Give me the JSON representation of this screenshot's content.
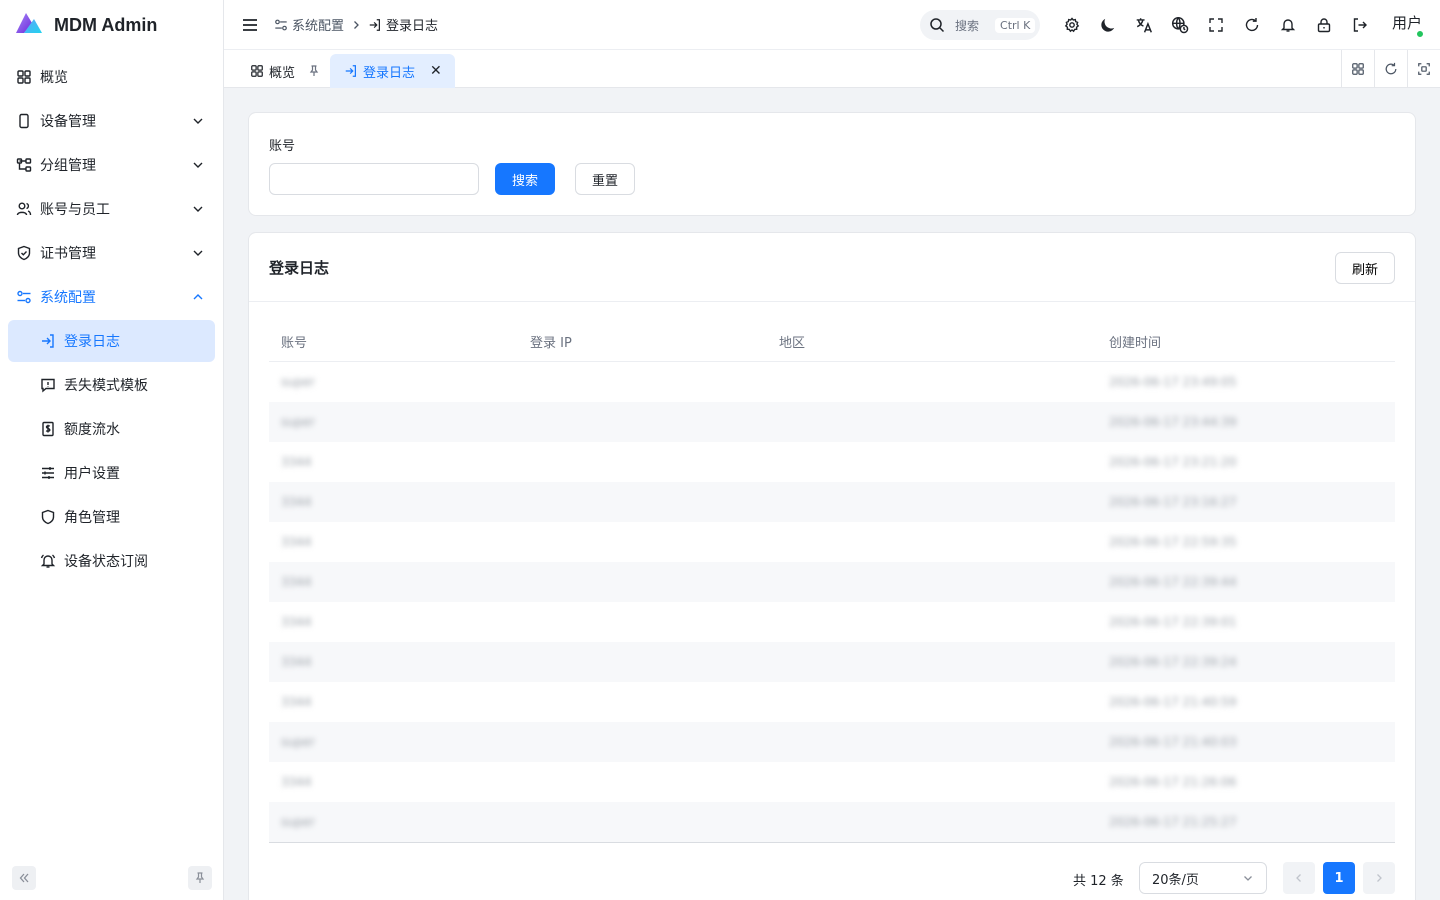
{
  "app": {
    "name": "MDM Admin"
  },
  "sidebar": {
    "items": [
      {
        "label": "概览",
        "icon": "dashboard-icon"
      },
      {
        "label": "设备管理",
        "icon": "phone-icon"
      },
      {
        "label": "分组管理",
        "icon": "tree-icon"
      },
      {
        "label": "账号与员工",
        "icon": "users-icon"
      },
      {
        "label": "证书管理",
        "icon": "shield-check-icon"
      },
      {
        "label": "系统配置",
        "icon": "settings-sliders-icon"
      }
    ],
    "sub_items": [
      {
        "label": "登录日志",
        "icon": "login-icon"
      },
      {
        "label": "丢失模式模板",
        "icon": "message-alert-icon"
      },
      {
        "label": "额度流水",
        "icon": "receipt-icon"
      },
      {
        "label": "用户设置",
        "icon": "sliders-icon"
      },
      {
        "label": "角色管理",
        "icon": "shield-icon"
      },
      {
        "label": "设备状态订阅",
        "icon": "bell-icon"
      }
    ]
  },
  "header": {
    "breadcrumb": [
      "系统配置",
      "登录日志"
    ],
    "search_label": "搜索",
    "search_shortcut": "Ctrl K",
    "user_label": "用户"
  },
  "tabs": [
    {
      "label": "概览"
    },
    {
      "label": "登录日志"
    }
  ],
  "filter": {
    "account_label": "账号",
    "account_value": "",
    "search_button": "搜索",
    "reset_button": "重置"
  },
  "table": {
    "title": "登录日志",
    "refresh_button": "刷新",
    "columns": [
      "账号",
      "登录 IP",
      "地区",
      "创建时间"
    ],
    "rows": [
      {
        "account": "super",
        "ip": "",
        "region": "",
        "created": "2026-06-17 23:49:05"
      },
      {
        "account": "super",
        "ip": "",
        "region": "",
        "created": "2026-06-17 23:44:39"
      },
      {
        "account": "3344",
        "ip": "",
        "region": "",
        "created": "2026-06-17 23:21:20"
      },
      {
        "account": "3344",
        "ip": "",
        "region": "",
        "created": "2026-06-17 23:16:27"
      },
      {
        "account": "3344",
        "ip": "",
        "region": "",
        "created": "2026-06-17 22:59:35"
      },
      {
        "account": "3344",
        "ip": "",
        "region": "",
        "created": "2026-06-17 22:39:44"
      },
      {
        "account": "3344",
        "ip": "",
        "region": "",
        "created": "2026-06-17 22:39:01"
      },
      {
        "account": "3344",
        "ip": "",
        "region": "",
        "created": "2026-06-17 22:39:24"
      },
      {
        "account": "3344",
        "ip": "",
        "region": "",
        "created": "2026-06-17 21:40:59"
      },
      {
        "account": "super",
        "ip": "",
        "region": "",
        "created": "2026-06-17 21:40:03"
      },
      {
        "account": "3344",
        "ip": "",
        "region": "",
        "created": "2026-06-17 21:26:06"
      },
      {
        "account": "super",
        "ip": "",
        "region": "",
        "created": "2026-06-17 21:25:27"
      }
    ]
  },
  "pagination": {
    "total_text": "共 12 条",
    "page_size": "20条/页",
    "current_page": "1"
  },
  "colors": {
    "primary": "#1677ff",
    "selected_bg": "#dce9ff",
    "online": "#22c55e"
  }
}
